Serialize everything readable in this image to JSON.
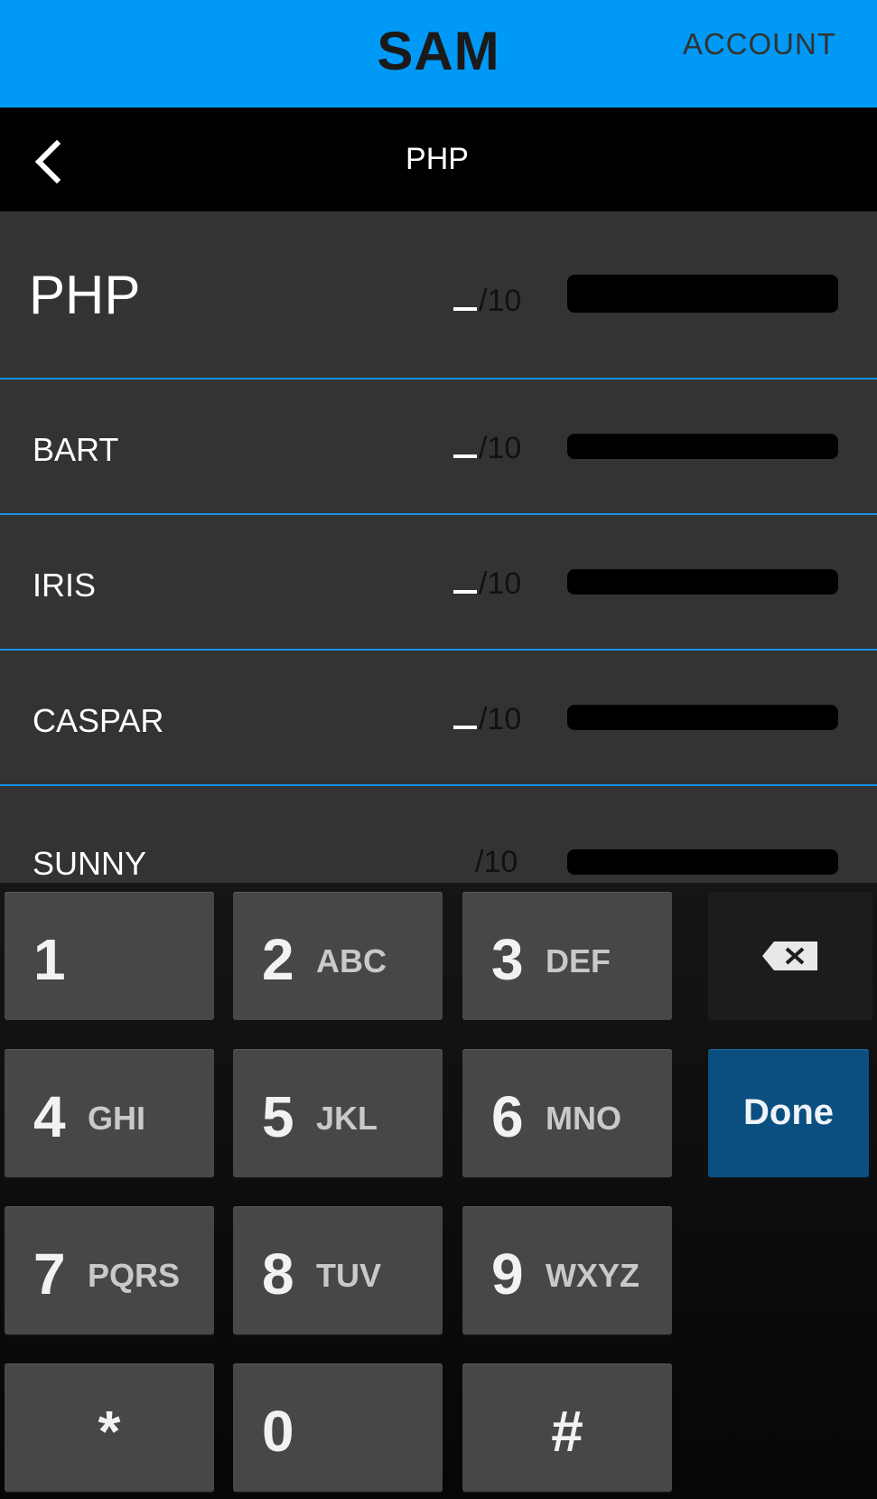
{
  "header": {
    "app_title": "SAM",
    "account_label": "ACCOUNT"
  },
  "nav": {
    "title": "PHP",
    "back_icon": "chevron-left-icon"
  },
  "ratings": {
    "summary": {
      "name": "PHP",
      "suffix": "/10"
    },
    "items": [
      {
        "name": "BART",
        "suffix": "/10"
      },
      {
        "name": "IRIS",
        "suffix": "/10"
      },
      {
        "name": "CASPAR",
        "suffix": "/10"
      },
      {
        "name": "SUNNY",
        "suffix": "/10"
      }
    ]
  },
  "keypad": {
    "keys": [
      {
        "digit": "1",
        "letters": ""
      },
      {
        "digit": "2",
        "letters": "ABC"
      },
      {
        "digit": "3",
        "letters": "DEF"
      },
      {
        "digit": "4",
        "letters": "GHI"
      },
      {
        "digit": "5",
        "letters": "JKL"
      },
      {
        "digit": "6",
        "letters": "MNO"
      },
      {
        "digit": "7",
        "letters": "PQRS"
      },
      {
        "digit": "8",
        "letters": "TUV"
      },
      {
        "digit": "9",
        "letters": "WXYZ"
      },
      {
        "digit": "*",
        "letters": ""
      },
      {
        "digit": "0",
        "letters": ""
      },
      {
        "digit": "#",
        "letters": ""
      }
    ],
    "done_label": "Done",
    "backspace_icon": "backspace-icon"
  },
  "colors": {
    "header_bg": "#0099f6",
    "divider": "#1793e6",
    "list_bg": "#333333",
    "done_bg": "#0a4f80"
  }
}
